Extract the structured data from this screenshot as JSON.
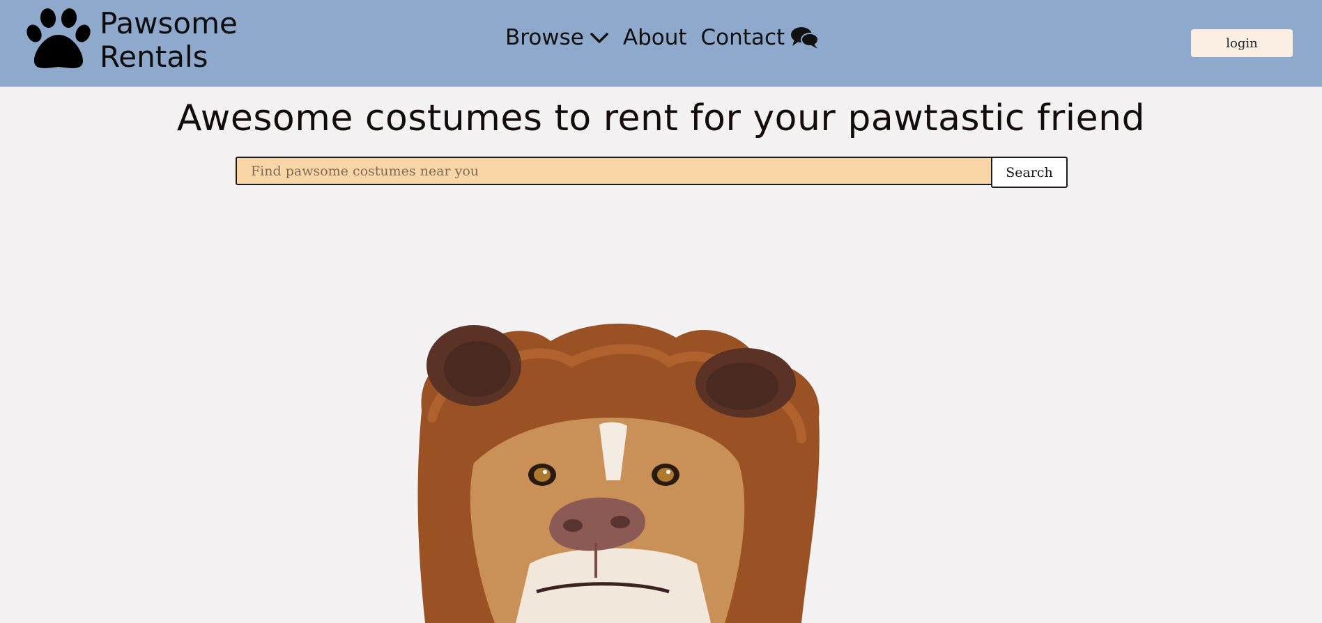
{
  "brand": {
    "line1": "Pawsome",
    "line2": "Rentals",
    "icon": "paw-icon"
  },
  "nav": {
    "browse": "Browse",
    "about": "About",
    "contact": "Contact"
  },
  "login_label": "login",
  "headline": "Awesome costumes to rent for your pawtastic friend",
  "search": {
    "placeholder": "Find pawsome costumes near you",
    "value": "",
    "button": "Search"
  },
  "hero": {
    "subject": "dog-in-bear-costume"
  },
  "colors": {
    "header": "#8fa9cc",
    "background": "#f3f1f2",
    "search_field": "#fad5a5",
    "login_button": "#fbeee3"
  }
}
